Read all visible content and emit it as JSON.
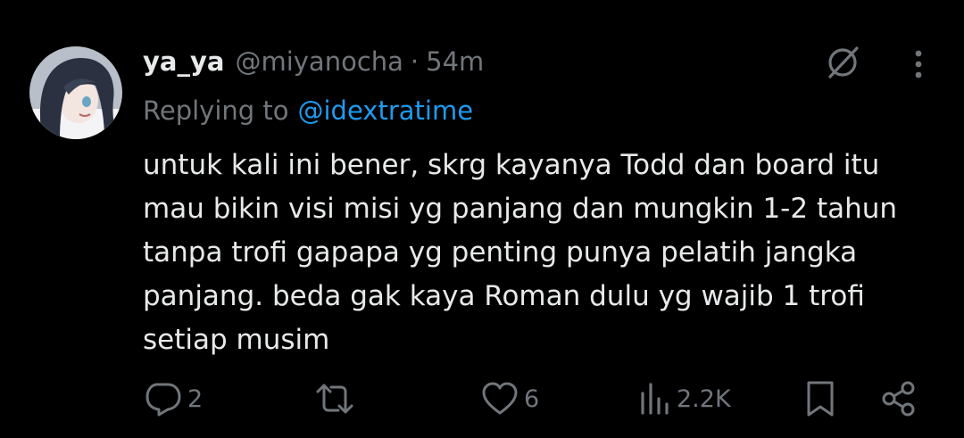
{
  "tweet": {
    "display_name": "ya_ya",
    "handle": "@miyanocha",
    "separator": "·",
    "time": "54m",
    "reply_prefix": "Replying to",
    "reply_to": "@idextratime",
    "text_lines": [
      "untuk kali ini bener, skrg kayanya Todd dan board itu",
      "mau bikin visi misi yg panjang dan mungkin 1-2 tahun",
      "tanpa trofi gapapa yg penting punya pelatih jangka",
      "panjang. beda gak kaya Roman dulu yg wajib 1 trofi",
      "setiap musim"
    ]
  },
  "actions": {
    "replies": "2",
    "likes": "6",
    "views": "2.2K"
  },
  "icons": {
    "avatar": "anime-avatar",
    "grok": "grok-icon",
    "more": "more-vertical-icon",
    "reply": "reply-icon",
    "retweet": "retweet-icon",
    "like": "heart-icon",
    "views": "views-icon",
    "bookmark": "bookmark-icon",
    "share": "share-icon"
  },
  "colors": {
    "background": "#000000",
    "text": "#e7e9ea",
    "muted": "#71767b",
    "link": "#1d9bf0"
  }
}
